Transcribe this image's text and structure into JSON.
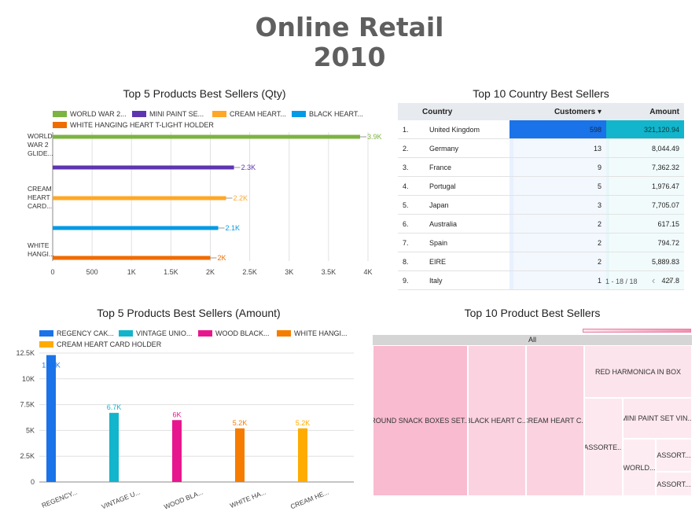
{
  "title_line1": "Online Retail",
  "title_line2": "2010",
  "qty_chart": {
    "title": "Top 5 Products Best Sellers (Qty)",
    "chart_data": {
      "type": "bar",
      "orientation": "horizontal",
      "title": "Top 5 Products Best Sellers (Qty)",
      "series": [
        {
          "name": "WORLD WAR 2...",
          "value": 3900,
          "label": "3.9K",
          "color": "#7cb342"
        },
        {
          "name": "MINI PAINT SE...",
          "value": 2300,
          "label": "2.3K",
          "color": "#5e35b1"
        },
        {
          "name": "CREAM HEART...",
          "value": 2200,
          "label": "2.2K",
          "color": "#ffa726"
        },
        {
          "name": "BLACK HEART...",
          "value": 2100,
          "label": "2.1K",
          "color": "#039be5"
        },
        {
          "name": "WHITE HANGING HEART T-LIGHT HOLDER",
          "value": 2000,
          "label": "2K",
          "color": "#ef6c00"
        }
      ],
      "category_labels": [
        [
          "WORLD",
          "WAR 2",
          "GLIDE..."
        ],
        [
          "CREAM",
          "HEART",
          "CARD..."
        ],
        [
          "WHITE",
          "HANGI..."
        ]
      ],
      "xlim": [
        0,
        4000
      ],
      "x_ticks": [
        "0",
        "500",
        "1K",
        "1.5K",
        "2K",
        "2.5K",
        "3K",
        "3.5K",
        "4K"
      ],
      "grid": true,
      "legend": "top"
    }
  },
  "country_table": {
    "title": "Top 10 Country Best Sellers",
    "headers": {
      "country": "Country",
      "customers": "Customers ▾",
      "amount": "Amount"
    },
    "rows": [
      {
        "idx": "1.",
        "country": "United Kingdom",
        "customers": "598",
        "amount": "321,120.94",
        "cust_frac": 1.0,
        "amt_frac": 1.0
      },
      {
        "idx": "2.",
        "country": "Germany",
        "customers": "13",
        "amount": "8,044.49",
        "cust_frac": 0.022,
        "amt_frac": 0.025
      },
      {
        "idx": "3.",
        "country": "France",
        "customers": "9",
        "amount": "7,362.32",
        "cust_frac": 0.015,
        "amt_frac": 0.023
      },
      {
        "idx": "4.",
        "country": "Portugal",
        "customers": "5",
        "amount": "1,976.47",
        "cust_frac": 0.008,
        "amt_frac": 0.006
      },
      {
        "idx": "5.",
        "country": "Japan",
        "customers": "3",
        "amount": "7,705.07",
        "cust_frac": 0.005,
        "amt_frac": 0.024
      },
      {
        "idx": "6.",
        "country": "Australia",
        "customers": "2",
        "amount": "617.15",
        "cust_frac": 0.003,
        "amt_frac": 0.002
      },
      {
        "idx": "7.",
        "country": "Spain",
        "customers": "2",
        "amount": "794.72",
        "cust_frac": 0.003,
        "amt_frac": 0.002
      },
      {
        "idx": "8.",
        "country": "EIRE",
        "customers": "2",
        "amount": "5,889.83",
        "cust_frac": 0.003,
        "amt_frac": 0.018
      },
      {
        "idx": "9.",
        "country": "Italy",
        "customers": "1",
        "amount": "427.8",
        "cust_frac": 0.002,
        "amt_frac": 0.001
      }
    ],
    "pager": "1 - 18 / 18",
    "prev_icon": "chevron-left-icon",
    "next_icon": "chevron-right-icon",
    "highlight_customers": "#1a73e8",
    "highlight_amount": "#12b5cb"
  },
  "amount_chart": {
    "title": "Top 5 Products Best Sellers (Amount)",
    "chart_data": {
      "type": "bar",
      "title": "Top 5 Products Best Sellers (Amount)",
      "series": [
        {
          "name": "REGENCY CAK...",
          "value": 12300,
          "label": "12.3K",
          "color": "#1a73e8",
          "tick": "REGENCY..."
        },
        {
          "name": "VINTAGE UNIO...",
          "value": 6700,
          "label": "6.7K",
          "color": "#12b5cb",
          "tick": "VINTAGE U..."
        },
        {
          "name": "WOOD BLACK...",
          "value": 6000,
          "label": "6K",
          "color": "#e8168e",
          "tick": "WOOD BLA..."
        },
        {
          "name": "WHITE HANGI...",
          "value": 5200,
          "label": "5.2K",
          "color": "#f57c00",
          "tick": "WHITE HA..."
        },
        {
          "name": "CREAM HEART CARD HOLDER",
          "value": 5200,
          "label": "5.2K",
          "color": "#ffab00",
          "tick": "CREAM HE..."
        }
      ],
      "ylim": [
        0,
        12500
      ],
      "y_ticks": [
        "0",
        "2.5K",
        "5K",
        "7.5K",
        "10K",
        "12.5K"
      ],
      "grid": true,
      "legend": "top"
    }
  },
  "treemap": {
    "title": "Top 10 Product Best Sellers",
    "root_label": "All",
    "chart_data": {
      "type": "treemap",
      "cells": [
        {
          "label": "ROUND SNACK BOXES SET...",
          "color": "#f8bbd0"
        },
        {
          "label": "BLACK HEART C...",
          "color": "#fbd3e0"
        },
        {
          "label": "CREAM HEART C...",
          "color": "#fbd3e0"
        },
        {
          "label": "RED HARMONICA IN BOX",
          "color": "#fce4ec"
        },
        {
          "label": "ASSORTE...",
          "color": "#fde8ef"
        },
        {
          "label": "MINI PAINT SET VIN...",
          "color": "#fde8ef"
        },
        {
          "label": "WORLD...",
          "color": "#fdedf2"
        },
        {
          "label": "ASSORT...",
          "color": "#fdedf2"
        },
        {
          "label": "ASSORT...",
          "color": "#fdedf2"
        }
      ]
    }
  }
}
